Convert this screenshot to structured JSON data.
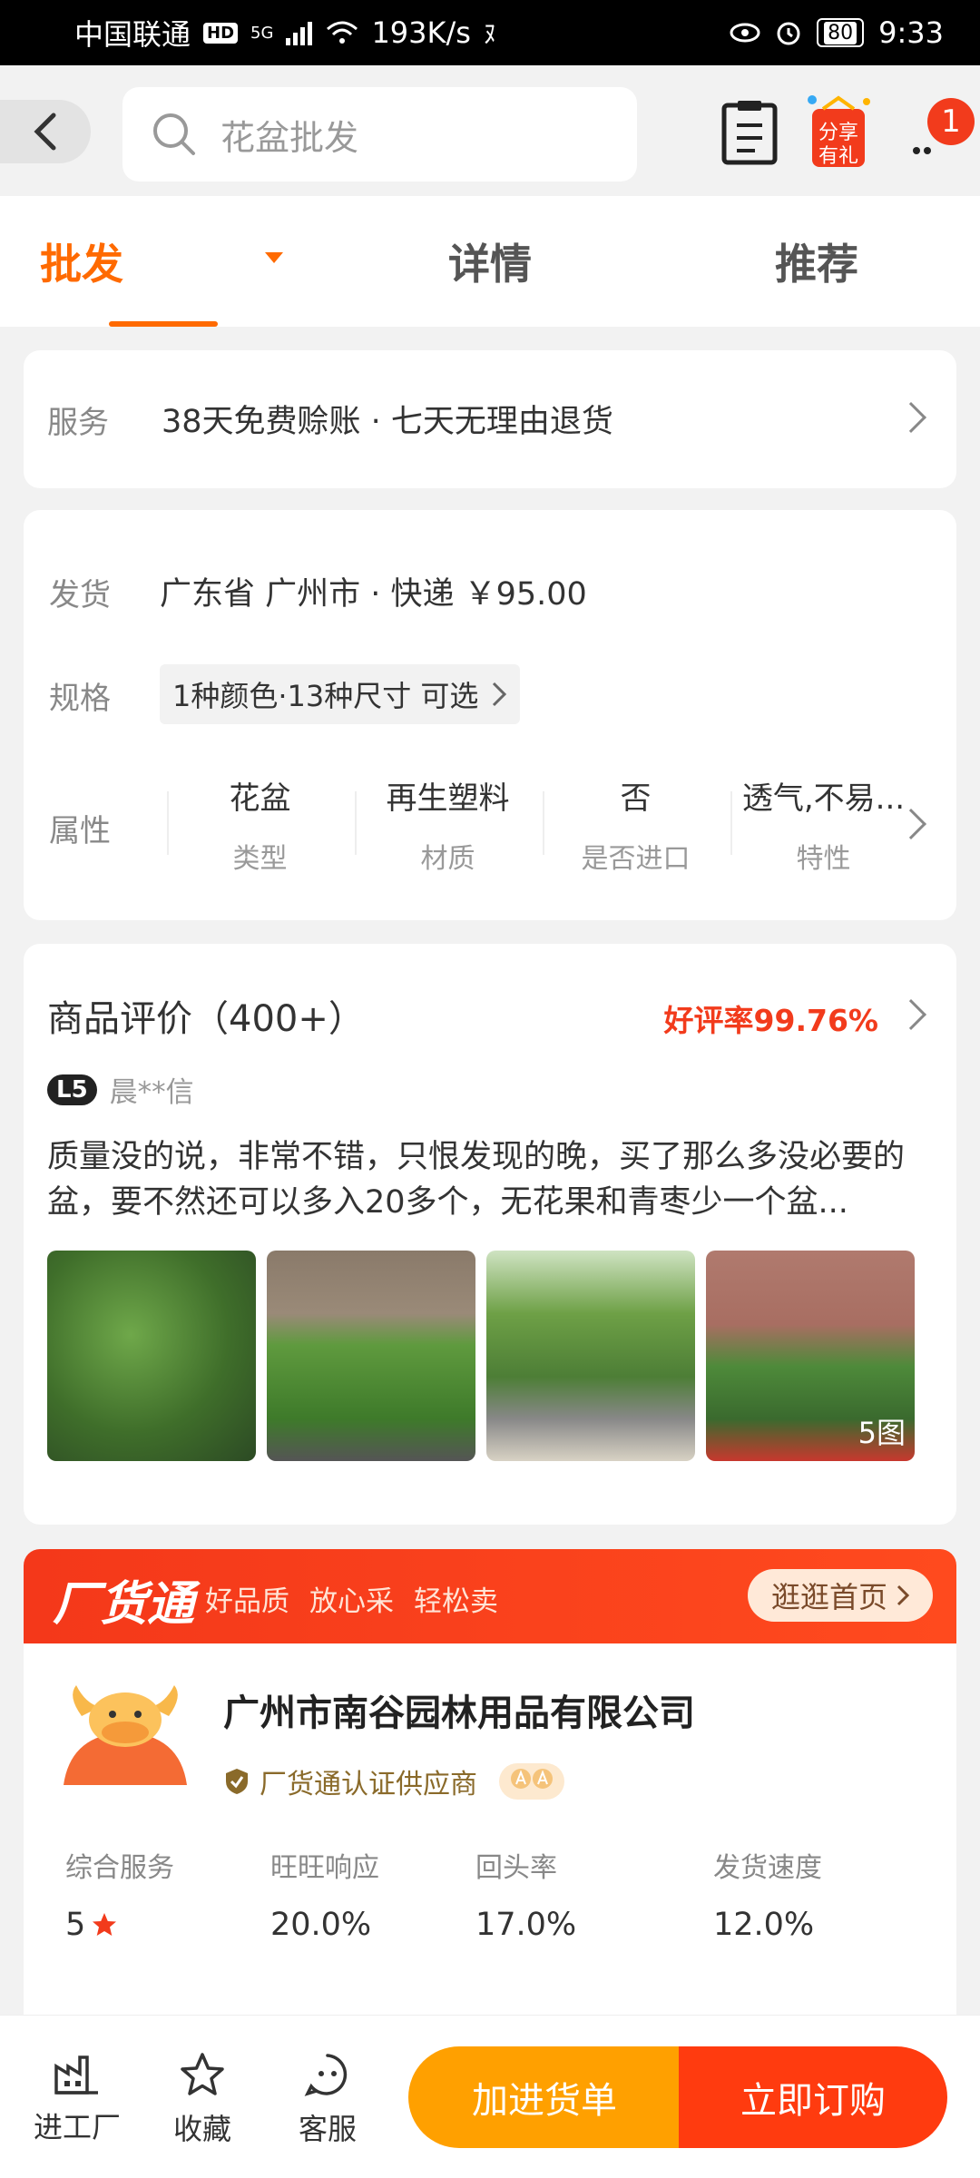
{
  "status_bar": {
    "carrier": "中国联通",
    "hd": "HD",
    "network": "5G",
    "speed": "193K/s",
    "battery": "80",
    "time": "9:33"
  },
  "header": {
    "search_placeholder": "花盆批发",
    "share_label_line1": "分享",
    "share_label_line2": "有礼",
    "more_badge": "1"
  },
  "tabs": [
    {
      "label": "批发",
      "active": true
    },
    {
      "label": "详情",
      "active": false
    },
    {
      "label": "推荐",
      "active": false
    }
  ],
  "service": {
    "label": "服务",
    "text": "38天免费赊账 · 七天无理由退货"
  },
  "shipping": {
    "label": "发货",
    "text": "广东省 广州市  ·  快递 ￥95.00"
  },
  "spec": {
    "label": "规格",
    "text": "1种颜色·13种尺寸 可选"
  },
  "attributes": {
    "label": "属性",
    "items": [
      {
        "value": "花盆",
        "key": "类型"
      },
      {
        "value": "再生塑料",
        "key": "材质"
      },
      {
        "value": "否",
        "key": "是否进口"
      },
      {
        "value": "透气,不易...",
        "key": "特性"
      }
    ]
  },
  "review": {
    "title": "商品评价（400+）",
    "rate": "好评率99.76%",
    "level": "L5",
    "user": "晨**信",
    "text": "质量没的说，非常不错，只恨发现的晚，买了那么多没必要的盆，要不然还可以多入20多个，无花果和青枣少一个盆...",
    "photo_count": "5图"
  },
  "factory": {
    "logo": "厂货通",
    "slogans": [
      "好品质",
      "放心采",
      "轻松卖"
    ],
    "home_button": "逛逛首页"
  },
  "company": {
    "name": "广州市南谷园林用品有限公司",
    "cert": "厂货通认证供应商",
    "stats": [
      {
        "key": "综合服务",
        "value": "5"
      },
      {
        "key": "旺旺响应",
        "value": "20.0%"
      },
      {
        "key": "回头率",
        "value": "17.0%"
      },
      {
        "key": "发货速度",
        "value": "12.0%"
      }
    ]
  },
  "bottom": {
    "factory": "进工厂",
    "favorite": "收藏",
    "service": "客服",
    "add_cart": "加进货单",
    "buy_now": "立即订购"
  },
  "colors": {
    "accent": "#ff6a00",
    "red": "#f23b1c",
    "cart_button": "#ffa000",
    "buy_button": "#ff3b0f"
  }
}
